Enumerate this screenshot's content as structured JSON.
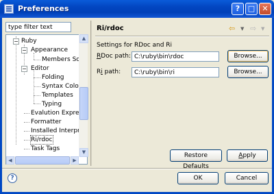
{
  "window": {
    "title": "Preferences",
    "help_glyph": "?",
    "max_glyph": "□",
    "close_glyph": "✕"
  },
  "filter": {
    "placeholder": "type filter text",
    "value": "type filter text"
  },
  "tree": {
    "items": [
      {
        "label": "Ruby",
        "expander": "−"
      },
      {
        "label": "Appearance",
        "expander": "−"
      },
      {
        "label": "Members Sort"
      },
      {
        "label": "Editor",
        "expander": "−"
      },
      {
        "label": "Folding"
      },
      {
        "label": "Syntax Colori"
      },
      {
        "label": "Templates"
      },
      {
        "label": "Typing"
      },
      {
        "label": "Evalution Express"
      },
      {
        "label": "Formatter"
      },
      {
        "label": "Installed Interpre"
      },
      {
        "label": "Ri/rdoc",
        "selected": true
      },
      {
        "label": "Task Tags"
      }
    ]
  },
  "page": {
    "title": "Ri/rdoc",
    "group_title": "Settings for RDoc and Ri",
    "rdoc": {
      "label_pre": "",
      "label_ul": "R",
      "label_post": "Doc path:",
      "value": "C:\\ruby\\bin\\rdoc",
      "browse": "Browse..."
    },
    "ri": {
      "label_pre": "R",
      "label_ul": "i",
      "label_post": " path:",
      "value": "C:\\ruby\\bin\\ri",
      "browse": "Browse..."
    },
    "restore_pre": "Restore ",
    "restore_ul": "D",
    "restore_post": "efaults",
    "apply_ul": "A",
    "apply_post": "pply"
  },
  "nav": {
    "back_icon": "⇦",
    "forward_icon": "⇨",
    "menu_icon": "▼"
  },
  "footer": {
    "ok": "OK",
    "cancel": "Cancel"
  },
  "icons": {
    "help": "question-circle-icon"
  }
}
